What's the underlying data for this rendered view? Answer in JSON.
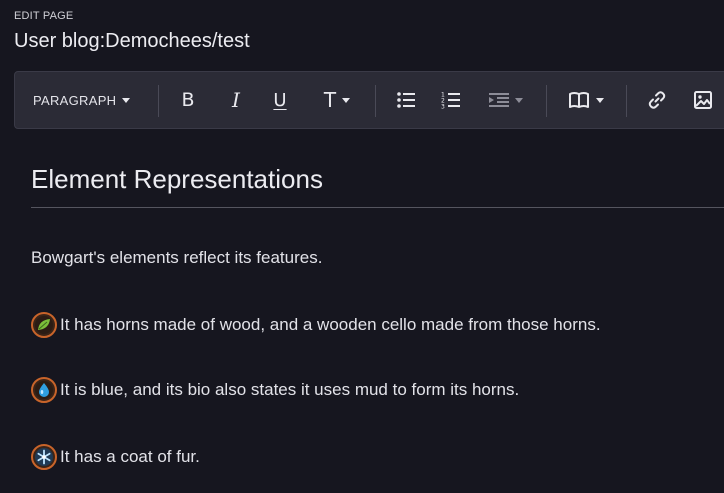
{
  "header": {
    "edit_label": "EDIT PAGE",
    "page_title": "User blog:Demochees/test"
  },
  "toolbar": {
    "paragraph_label": "PARAGRAPH",
    "bold_label": "B",
    "italic_label": "I",
    "underline_label": "U",
    "text_style_label": "T",
    "icons": [
      "chevron-down-icon",
      "bullet-list-icon",
      "numbered-list-icon",
      "indent-icon",
      "book-icon",
      "link-icon",
      "image-icon"
    ]
  },
  "content": {
    "heading": "Element Representations",
    "intro": "Bowgart's elements reflect its features.",
    "items": [
      {
        "icon": "plant-element-icon",
        "text": "It has horns made of wood, and a wooden cello made from those horns."
      },
      {
        "icon": "water-element-icon",
        "text": "It is blue, and its bio also states it uses mud to form its horns."
      },
      {
        "icon": "cold-element-icon",
        "text": "It has a coat of fur."
      }
    ]
  },
  "colors": {
    "background": "#16161f",
    "toolbar": "#2b2b36",
    "plant": "#7bbf3a",
    "water": "#2f9fe0",
    "cold": "#bfe6ff",
    "badge_ring": "#c8642a"
  }
}
